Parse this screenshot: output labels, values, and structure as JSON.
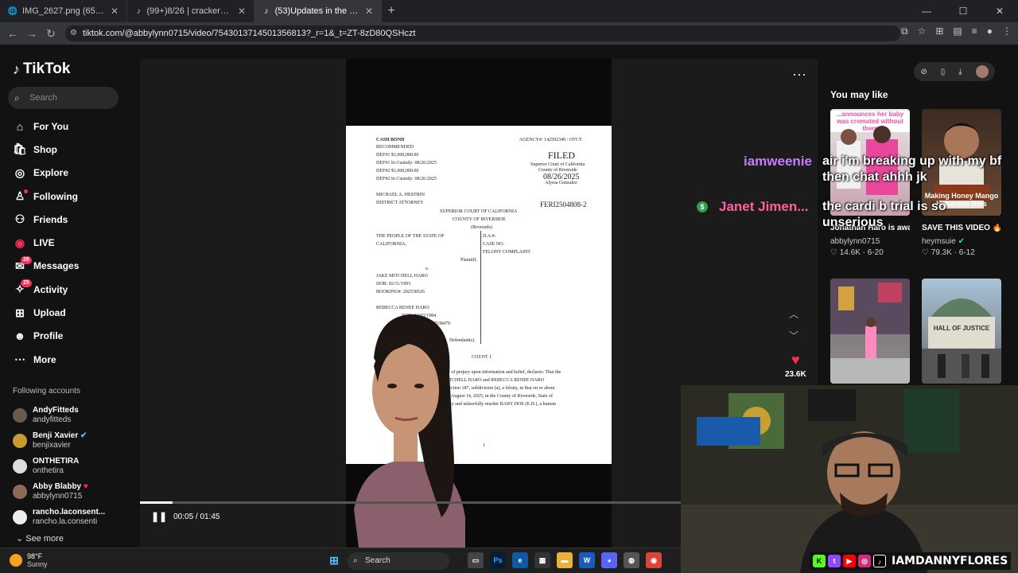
{
  "browser": {
    "tabs": [
      {
        "title": "IMG_2627.png (651×960)",
        "active": false
      },
      {
        "title": "(99+)8/26 | crackerbarrel logo |",
        "active": false
      },
      {
        "title": "(53)Updates in the Emman",
        "active": true
      }
    ],
    "url": "tiktok.com/@abbylynn0715/video/7543013714501356813?_r=1&_t=ZT-8zD80QSHczt"
  },
  "tiktok": {
    "logo_text": "TikTok",
    "search_placeholder": "Search",
    "nav": [
      {
        "label": "For You",
        "icon": "home-icon"
      },
      {
        "label": "Shop",
        "icon": "shop-icon"
      },
      {
        "label": "Explore",
        "icon": "compass-icon"
      },
      {
        "label": "Following",
        "icon": "following-icon"
      },
      {
        "label": "Friends",
        "icon": "friends-icon"
      },
      {
        "label": "LIVE",
        "icon": "live-icon"
      },
      {
        "label": "Messages",
        "icon": "messages-icon",
        "badge": "28"
      },
      {
        "label": "Activity",
        "icon": "activity-icon",
        "badge": "25"
      },
      {
        "label": "Upload",
        "icon": "upload-icon"
      },
      {
        "label": "Profile",
        "icon": "profile-icon"
      },
      {
        "label": "More",
        "icon": "more-icon"
      }
    ],
    "following_title": "Following accounts",
    "accounts": [
      {
        "name": "AndyFitteds",
        "handle": "andyfitteds"
      },
      {
        "name": "Benji Xavier",
        "handle": "benjixavier"
      },
      {
        "name": "ONTHETIRA",
        "handle": "onthetira"
      },
      {
        "name": "Abby Blabby",
        "handle": "abbylynn0715"
      },
      {
        "name": "rancho.laconsent...",
        "handle": "rancho.la.consenti"
      }
    ],
    "see_more": "See more",
    "video": {
      "time": "00:05 / 01:45",
      "progress": 0.06,
      "author": "abbylynn0715",
      "likes": "23.6K"
    },
    "document": {
      "cash_bond": "CASH BOND",
      "recommended": "RECOMMENDED",
      "def1": "DEF#1 $1,000,000.00",
      "def1c": "DEF#1 In Custody: 08/26/2025",
      "def2": "DEF#2 $1,000,000.00",
      "def2c": "DEF#2 In Custody: 08/26/2025",
      "agency": "AGENCY#: 142502349 / OTCY",
      "filed": "FILED",
      "court1": "Superior Court of California",
      "court2": "County of Riverside",
      "date": "08/26/2025",
      "clerk": "Alyssa Gonzalez",
      "da1": "MICHAEL A. HESTRIN",
      "da2": "DISTRICT ATTORNEY",
      "case_no": "FERI2504808-2",
      "head1": "SUPERIOR COURT OF CALIFORNIA",
      "head2": "COUNTY OF RIVERSIDE",
      "head3": "(Riverside)",
      "people1": "THE PEOPLE OF THE STATE OF",
      "people2": "CALIFORNIA,",
      "dalbl": "D.A.#:",
      "caselbl": "CASE NO.",
      "felony": "FELONY COMPLAINT",
      "plaintiff": "Plaintiff,",
      "v": "v.",
      "def_name": "JAKE MITCHELL HARO",
      "dob": "DOB: 02/11/1993",
      "booking": "BOOKING#: 202538526",
      "def2_name": "REBECCA RENEE HARO",
      "dob2": "DOB: 10/03/1984",
      "booking2": "BOOKING#: 202538479",
      "defendants": "Defendant(s).",
      "count": "COUNT 1",
      "body1": "under penalty of perjury upon information and belief, declares: That the",
      "body2": "(s) JAKE MITCHELL HARO and REBECCA RENEE HARO",
      "body3": "Penal Code section 187, subdivision (a), a felony, in that on or about",
      "body4": "and including August 14, 2025, in the County of Riverside, State of",
      "body5": "(s) did willfully and unlawfully murder BABY DOE (E.H.), a human",
      "page": "1"
    },
    "you_may_like": "You may like",
    "cards": [
      {
        "title": "Jonathan Haro is awarded Jessica...",
        "user": "abbylynn0715",
        "likes": "14.6K",
        "date": "6-20"
      },
      {
        "title": "SAVE THIS VIDEO 🔥 🔥 #chefsuie...",
        "user": "heymsuie",
        "likes": "79.3K",
        "date": "6-12"
      },
      {
        "title": "",
        "user": "",
        "likes": "",
        "date": ""
      },
      {
        "title": "",
        "user": "",
        "likes": "",
        "date": ""
      }
    ],
    "thumb_text_1": "...announces her baby was cremated without them",
    "thumb_text_2": "Making Honey Mango Habanero Ribs",
    "thumb_text_4": "HALL OF JUSTICE"
  },
  "overlay_chat": [
    {
      "name": "iamweenie",
      "message": "air i'm breaking up with my bf then chat ahhh jk",
      "color": "#c77dff"
    },
    {
      "name": "Janet Jimen...",
      "message": "the cardi b trial is so unserious",
      "color": "#ff5fa2"
    }
  ],
  "stream": {
    "handle": "IAMDANNYFLORES"
  },
  "taskbar": {
    "temp": "98°F",
    "condition": "Sunny",
    "search": "Search"
  }
}
